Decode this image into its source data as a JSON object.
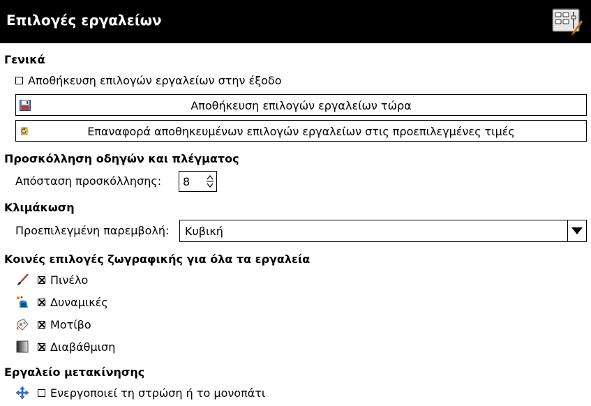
{
  "header": {
    "title": "Επιλογές εργαλείων",
    "icon": "tool-options-icon"
  },
  "general": {
    "heading": "Γενικά",
    "save_on_exit_label": "Αποθήκευση επιλογών εργαλείων στην έξοδο",
    "save_on_exit_checked": false,
    "save_now_label": "Αποθήκευση επιλογών εργαλείων τώρα",
    "reset_label": "Επαναφορά αποθηκευμένων επιλογών εργαλείων στις προεπιλεγμένες τιμές"
  },
  "snapping": {
    "heading": "Προσκόλληση οδηγών και πλέγματος",
    "distance_label": "Απόσταση προσκόλλησης:",
    "distance_value": "8"
  },
  "scaling": {
    "heading": "Κλιμάκωση",
    "interpolation_label": "Προεπιλεγμένη παρεμβολή:",
    "interpolation_value": "Κυβική"
  },
  "paint_options": {
    "heading": "Κοινές επιλογές ζωγραφικής για όλα τα εργαλεία",
    "items": [
      {
        "label": "Πινέλο",
        "checked": true,
        "icon": "brush-icon"
      },
      {
        "label": "Δυναμικές",
        "checked": true,
        "icon": "dynamics-icon"
      },
      {
        "label": "Μοτίβο",
        "checked": true,
        "icon": "pattern-icon"
      },
      {
        "label": "Διαβάθμιση",
        "checked": true,
        "icon": "gradient-icon"
      }
    ]
  },
  "move_tool": {
    "heading": "Εργαλείο μετακίνησης",
    "activate_label": "Ενεργοποιεί τη στρώση ή το μονοπάτι",
    "activate_checked": false,
    "icon": "move-icon"
  },
  "colors": {
    "header_bg": "#000000",
    "header_fg": "#ffffff"
  }
}
